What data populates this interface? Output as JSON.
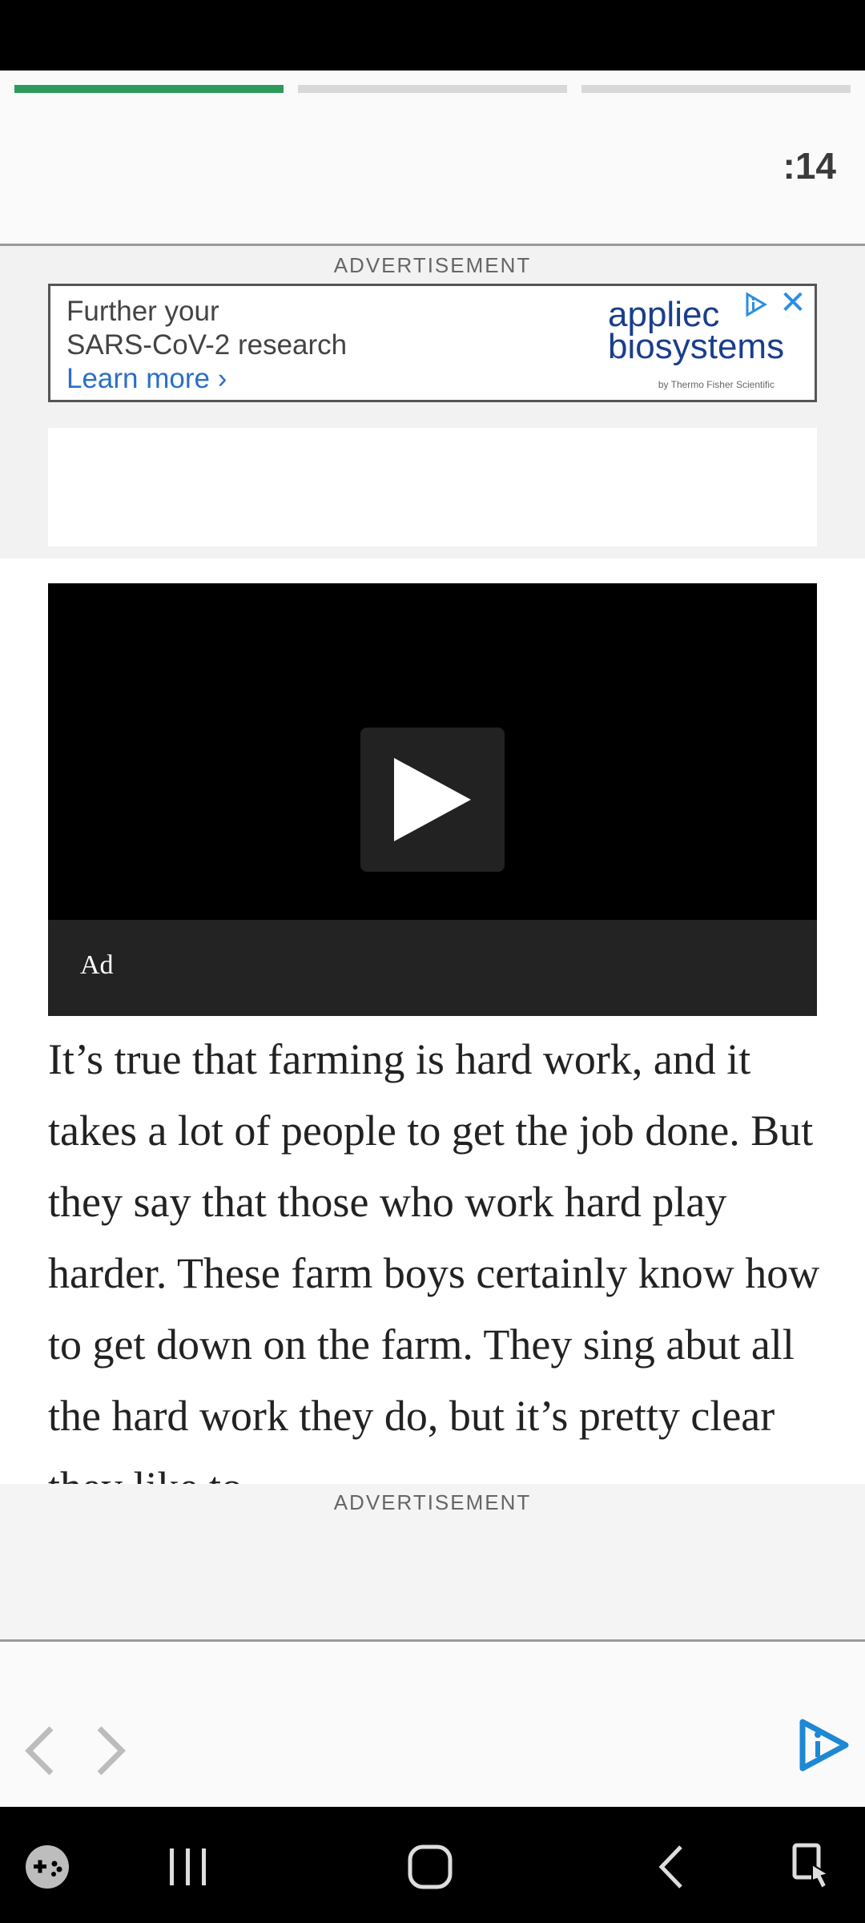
{
  "story": {
    "segments": [
      1,
      0,
      0
    ],
    "accent_color": "#2e9a5a",
    "timer": ":14"
  },
  "ads": {
    "top_label": "ADVERTISEMENT",
    "banner": {
      "line1": "Further your",
      "line2": "SARS-CoV-2 research",
      "link": "Learn more ›",
      "brand_line1": "appliec",
      "brand_line2": "biosystems",
      "brand_sub": "by Thermo Fisher Scientific"
    },
    "bottom_label": "ADVERTISEMENT"
  },
  "video": {
    "ad_label": "Ad"
  },
  "article": {
    "text": "It’s true that farming is hard work, and it takes a lot of people to get the job done. But they say that those who work hard play harder. These farm boys certainly know how to get down on the farm. They sing abut all the hard work they do, but it’s pretty clear they like to"
  },
  "icons": {
    "prev": "chevron-left-icon",
    "next": "chevron-right-icon",
    "brand": "brand-logo-icon",
    "game": "game-launcher-icon",
    "recents": "recents-icon",
    "home": "home-icon",
    "back": "back-icon",
    "accessibility": "accessibility-icon"
  }
}
